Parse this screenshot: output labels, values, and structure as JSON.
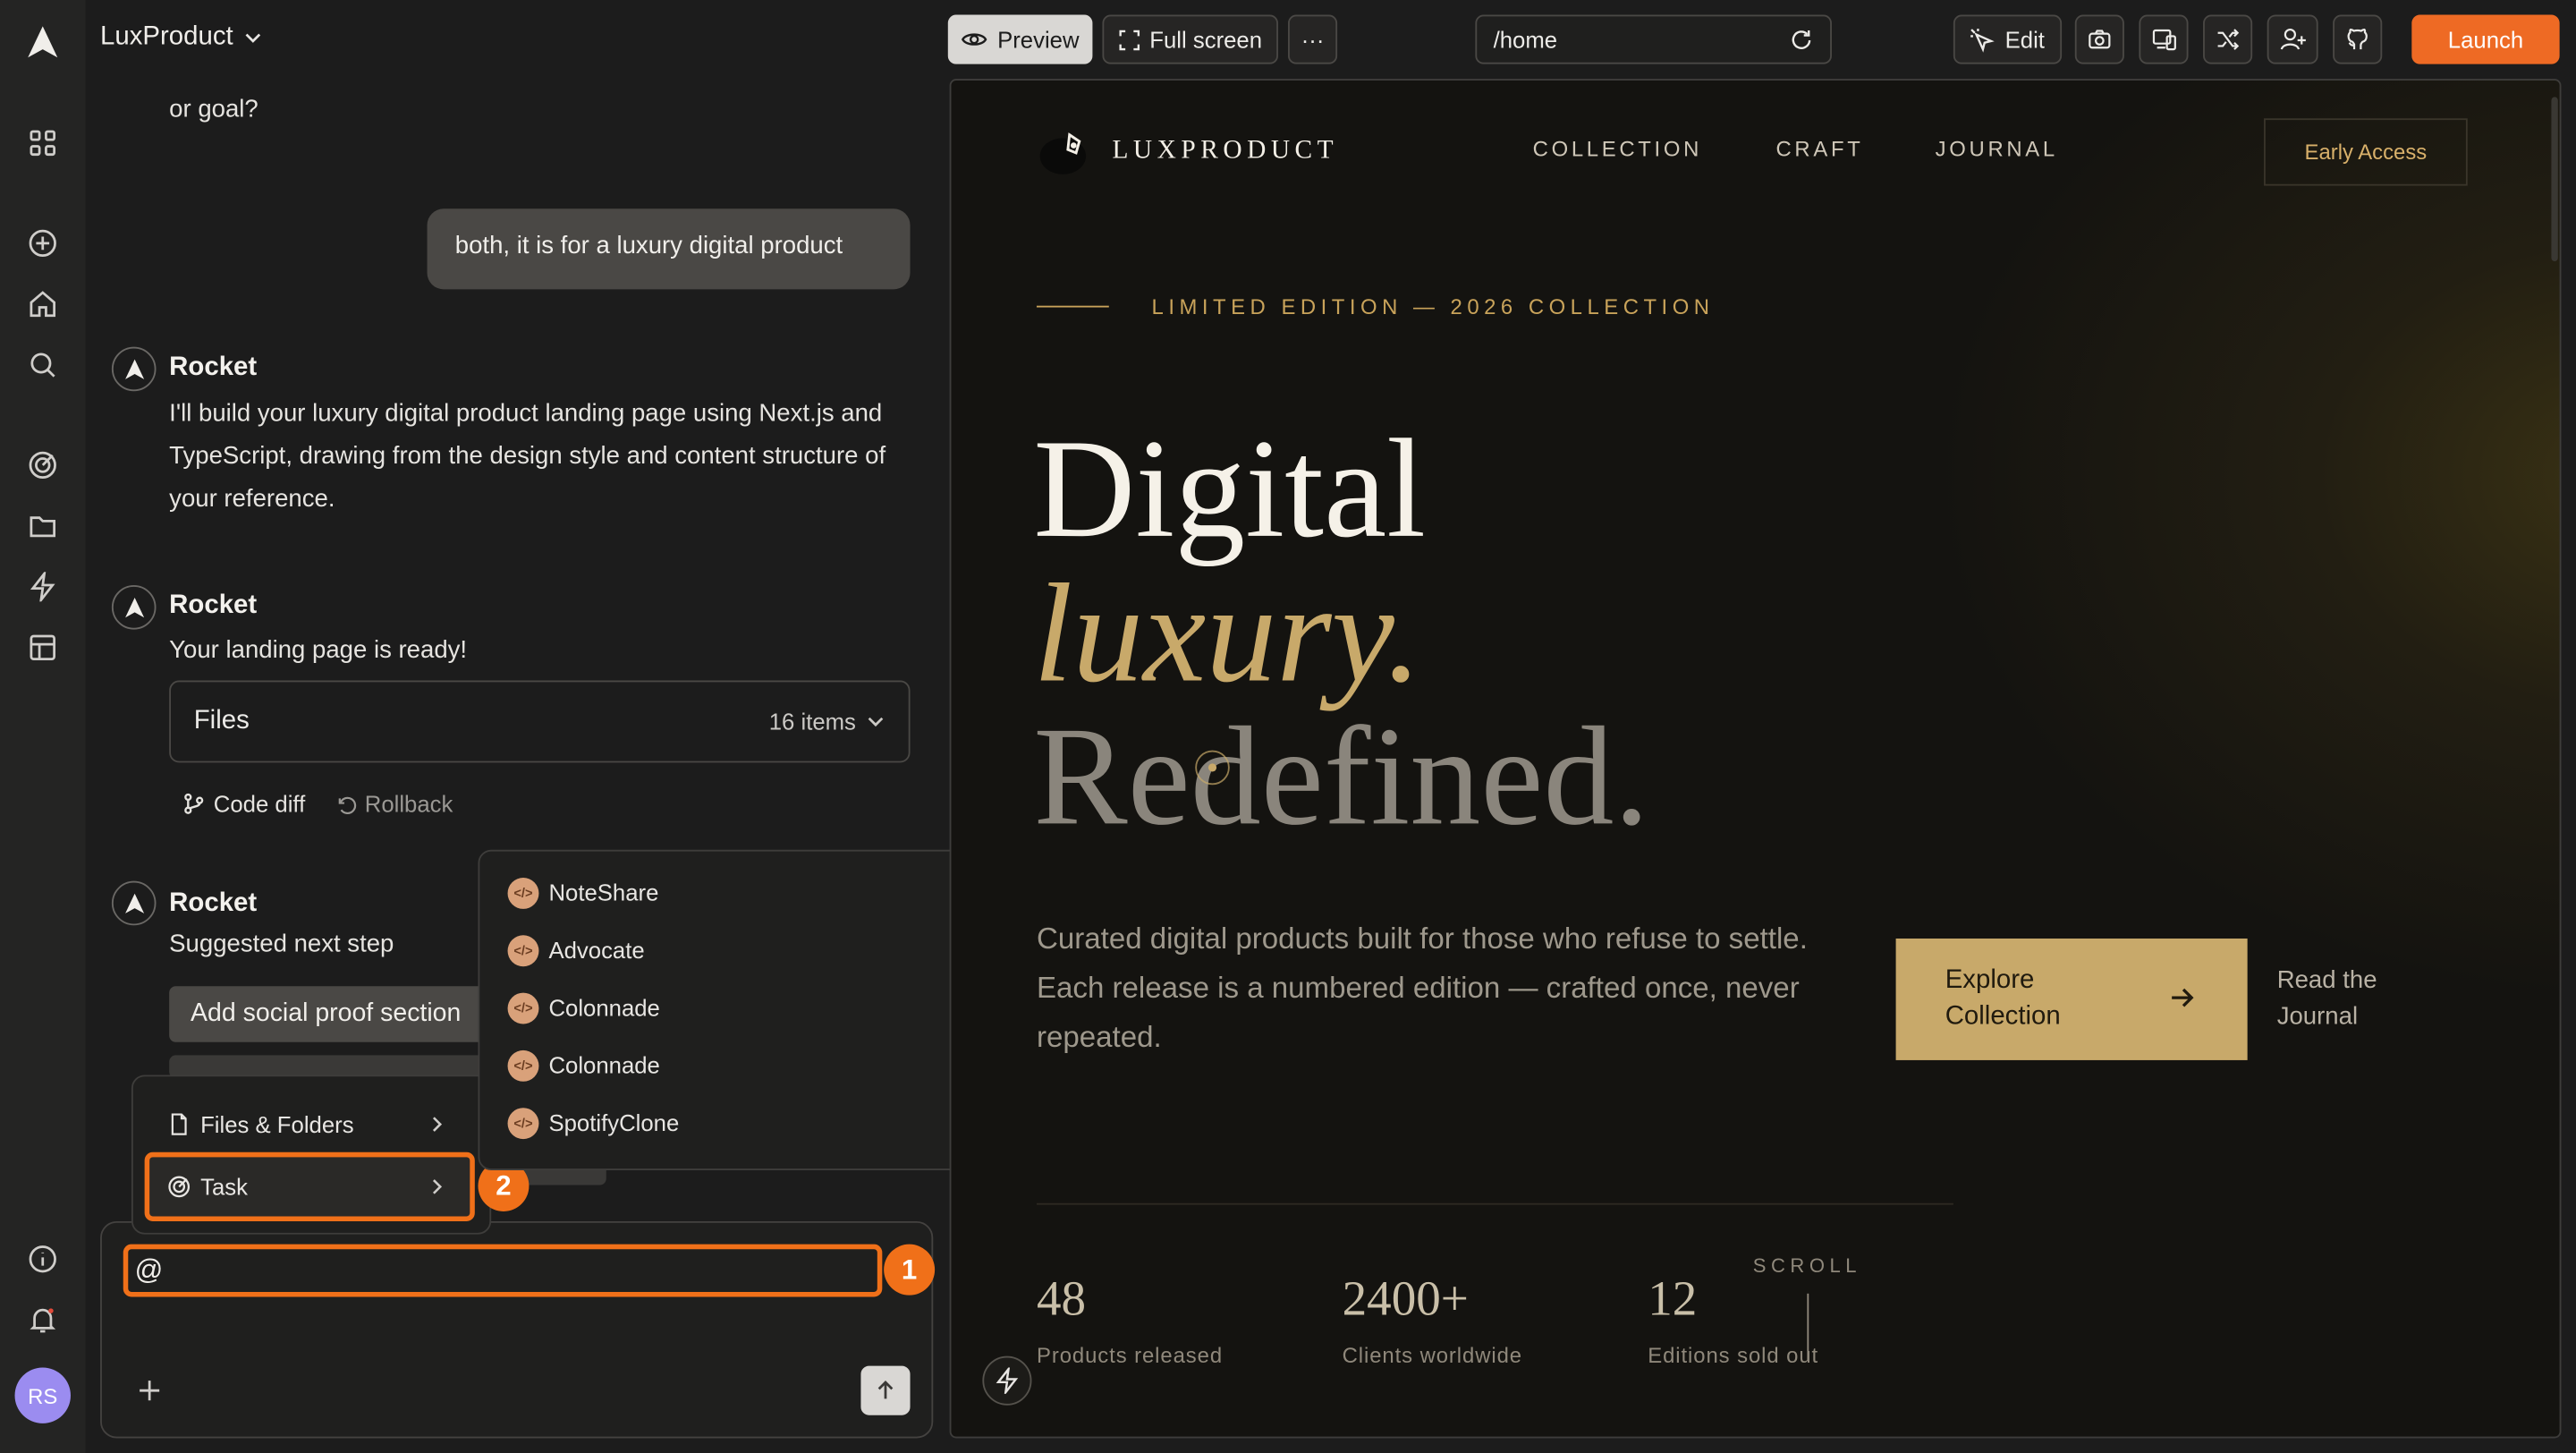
{
  "app": {
    "title": "LuxProduct"
  },
  "rail": {
    "icons": [
      "logo-icon",
      "grid-icon",
      "plus-circle-icon",
      "home-icon",
      "search-icon",
      "target-icon",
      "folder-icon",
      "bolt-icon",
      "layout-icon",
      "info-icon",
      "bell-icon"
    ],
    "avatar_initials": "RS"
  },
  "chat": {
    "earlier_text": "or goal?",
    "user_message": "both, it is for a luxury digital product",
    "bot_name": "Rocket",
    "messages": [
      {
        "author": "Rocket",
        "text": "I'll build your luxury digital product landing page using Next.js and TypeScript, drawing from the design style and content structure of your reference."
      },
      {
        "author": "Rocket",
        "text": "Your landing page is ready!"
      },
      {
        "author": "Rocket",
        "text": "Suggested next step"
      }
    ],
    "files": {
      "label": "Files",
      "count": "16 items"
    },
    "actions": {
      "code_diff": "Code diff",
      "rollback": "Rollback"
    },
    "suggestion": "Add social proof section"
  },
  "composer": {
    "value": "@"
  },
  "mention_menu": {
    "items": [
      {
        "label": "Files & Folders",
        "icon": "file-icon"
      },
      {
        "label": "Task",
        "icon": "target-icon"
      }
    ],
    "submenu": [
      "NoteShare",
      "Advocate",
      "Colonnade",
      "Colonnade",
      "SpotifyClone"
    ]
  },
  "annotations": {
    "badge1": "1",
    "badge2": "2",
    "color": "#f07019"
  },
  "toolbar": {
    "preview": "Preview",
    "fullscreen": "Full screen",
    "more": "···",
    "url": "/home",
    "edit": "Edit",
    "launch": "Launch"
  },
  "preview": {
    "brand": "LUXPRODUCT",
    "nav": [
      "COLLECTION",
      "CRAFT",
      "JOURNAL"
    ],
    "early_access": "Early Access",
    "eyebrow": "LIMITED EDITION — 2026 COLLECTION",
    "headline": [
      "Digital",
      "luxury.",
      "Redefined."
    ],
    "description": "Curated digital products built for those who refuse to settle. Each release is a numbered edition — crafted once, never repeated.",
    "cta": "Explore Collection",
    "read_link": "Read the Journal",
    "scroll_label": "SCROLL",
    "stats": [
      {
        "value": "48",
        "label": "Products released"
      },
      {
        "value": "2400+",
        "label": "Clients worldwide"
      },
      {
        "value": "12",
        "label": "Editions sold out"
      }
    ],
    "colors": {
      "gold": "#c8a96a",
      "accent": "#c9a35a"
    }
  }
}
